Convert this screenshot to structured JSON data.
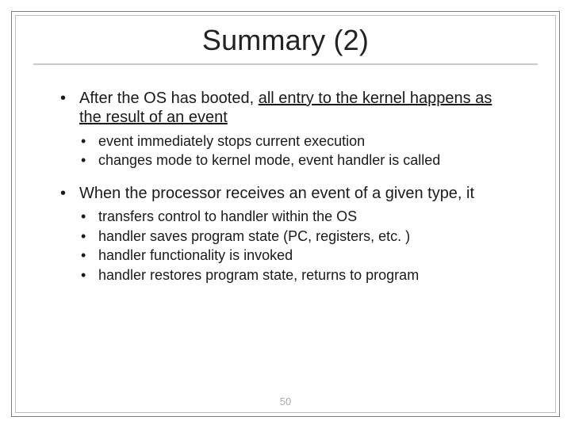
{
  "title": "Summary (2)",
  "slide_number": "50",
  "bullets": [
    {
      "text_pre": "After the OS has booted,",
      "text_under": "all entry to the kernel happens as the result of an event",
      "sub": [
        "event immediately stops current execution",
        "changes mode to kernel mode, event handler is called"
      ]
    },
    {
      "text_pre": "When the processor receives an event of a given type, it",
      "text_under": "",
      "sub": [
        "transfers control to handler within the OS",
        "handler saves program state (PC, registers, etc. )",
        "handler functionality is invoked",
        "handler restores program state, returns to program"
      ]
    }
  ]
}
